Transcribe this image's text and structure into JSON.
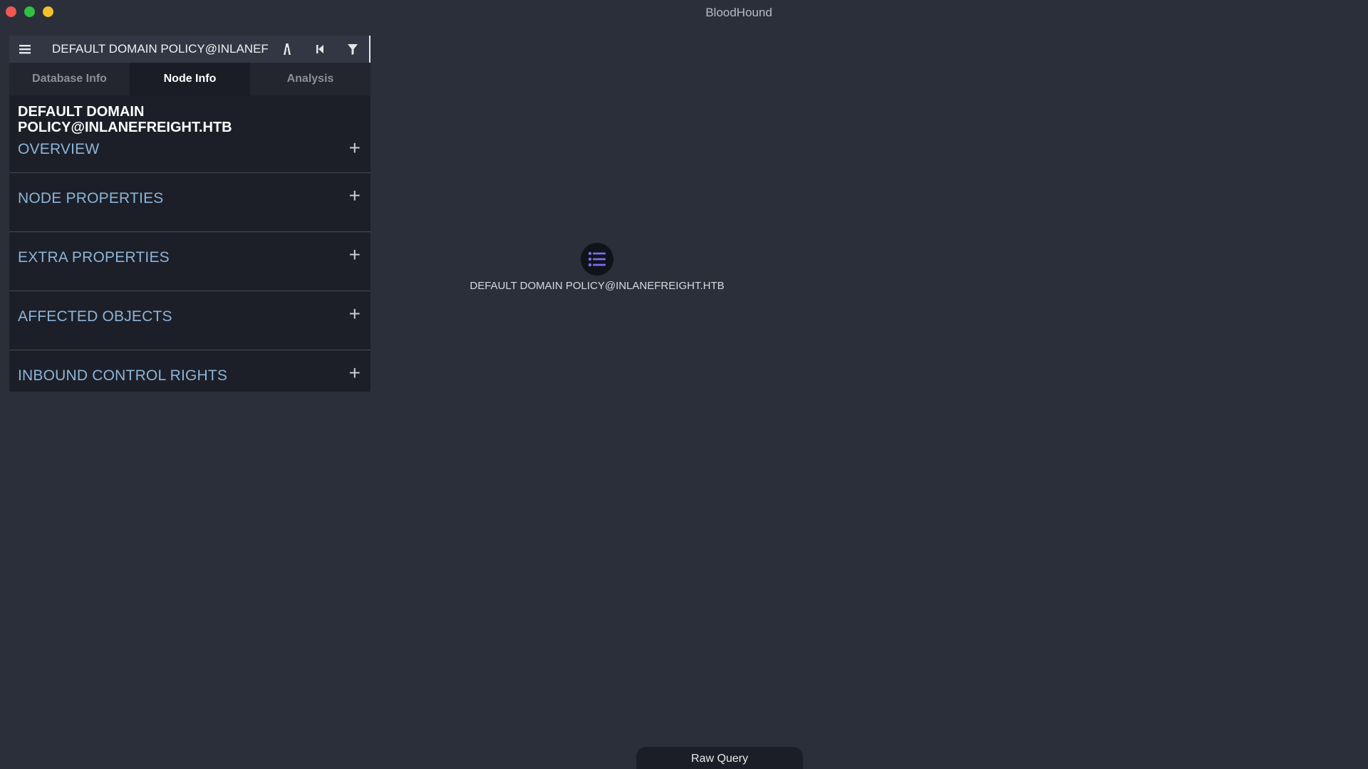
{
  "window": {
    "title": "BloodHound"
  },
  "search": {
    "value": "DEFAULT DOMAIN POLICY@INLANEF"
  },
  "toolbar": {
    "menu_icon": "hamburger-menu-icon",
    "pathfinding_icon": "path-icon",
    "back_icon": "back-icon",
    "filter_icon": "filter-icon"
  },
  "tabs": [
    {
      "label": "Database Info",
      "active": false
    },
    {
      "label": "Node Info",
      "active": true
    },
    {
      "label": "Analysis",
      "active": false
    }
  ],
  "node_info": {
    "title_line1": "DEFAULT DOMAIN",
    "title_line2": "POLICY@INLANEFREIGHT.HTB",
    "sections": [
      {
        "label": "OVERVIEW"
      },
      {
        "label": "NODE PROPERTIES"
      },
      {
        "label": "EXTRA PROPERTIES"
      },
      {
        "label": "AFFECTED OBJECTS"
      },
      {
        "label": "INBOUND CONTROL RIGHTS"
      }
    ],
    "expand_symbol": "+"
  },
  "graph": {
    "node": {
      "label": "DEFAULT DOMAIN POLICY@INLANEFREIGHT.HTB",
      "icon": "gpo-list-icon",
      "icon_color": "#7b6cf0"
    }
  },
  "raw_query": {
    "label": "Raw Query"
  },
  "colors": {
    "background": "#2b2f3a",
    "panel": "#1c1f28",
    "section_label": "#8db4d8"
  }
}
